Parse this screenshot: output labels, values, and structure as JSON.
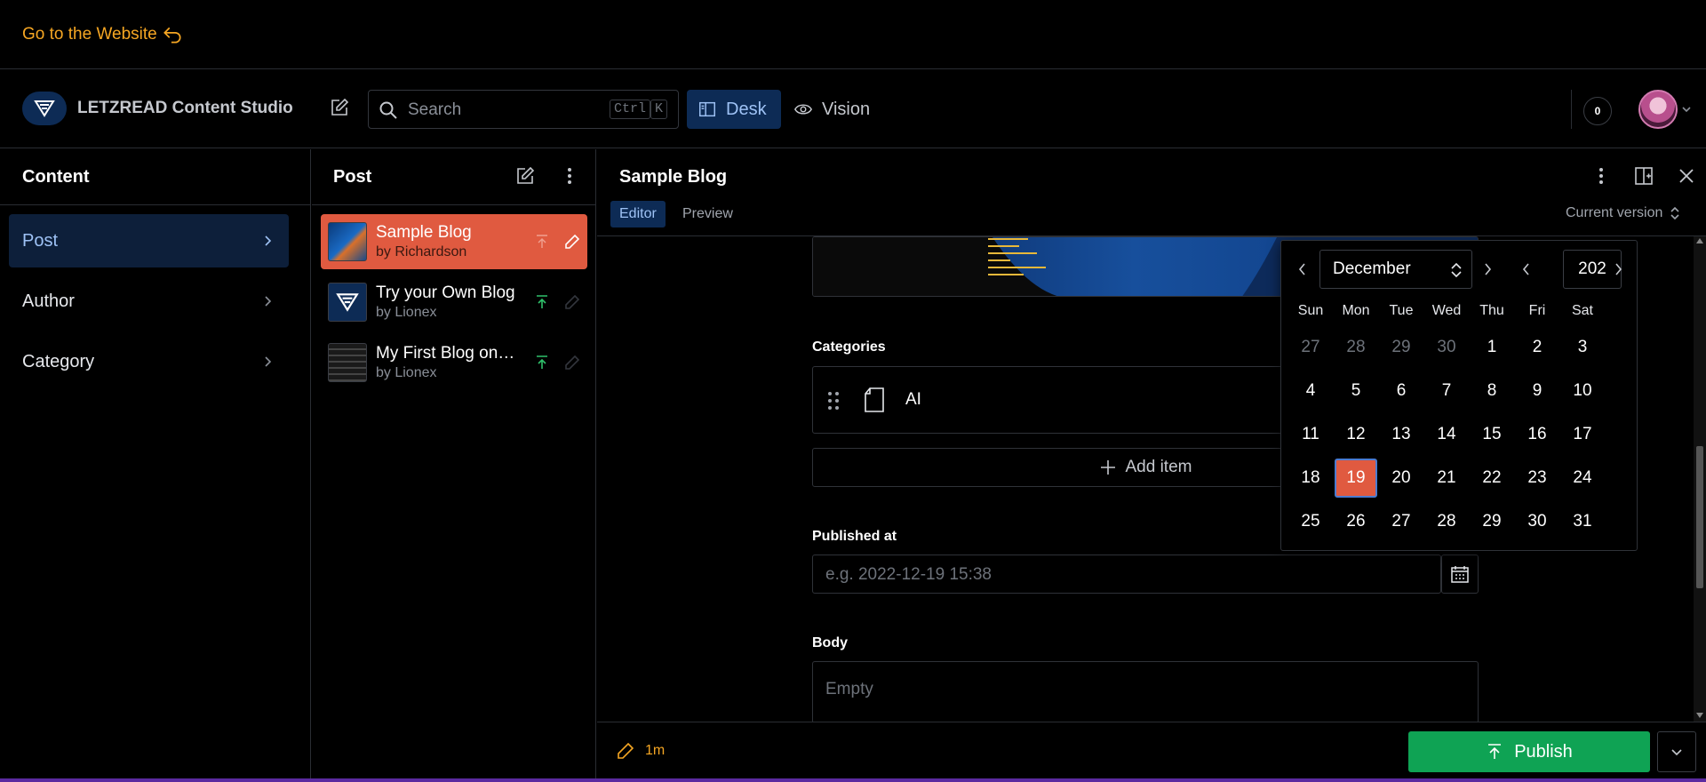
{
  "banner": {
    "link_label": "Go to the Website"
  },
  "navbar": {
    "brand_title": "LETZREAD Content Studio",
    "search_placeholder": "Search",
    "kbd_ctrl": "Ctrl",
    "kbd_k": "K",
    "desk_label": "Desk",
    "vision_label": "Vision",
    "notification_count": "0"
  },
  "content_pane": {
    "title": "Content",
    "items": [
      {
        "label": "Post"
      },
      {
        "label": "Author"
      },
      {
        "label": "Category"
      }
    ]
  },
  "post_pane": {
    "title": "Post",
    "documents": [
      {
        "title": "Sample Blog",
        "subtitle": "by Richardson"
      },
      {
        "title": "Try your Own Blog",
        "subtitle": "by Lionex"
      },
      {
        "title": "My First Blog on Sanity",
        "subtitle": "by Lionex"
      }
    ]
  },
  "document": {
    "title": "Sample Blog",
    "tabs": [
      {
        "label": "Editor"
      },
      {
        "label": "Preview"
      }
    ],
    "version_label": "Current version",
    "categories_label": "Categories",
    "category_item": "AI",
    "add_item_label": "Add item",
    "published_at_label": "Published at",
    "published_at_placeholder": "e.g. 2022-12-19 15:38",
    "body_label": "Body",
    "body_placeholder": "Empty"
  },
  "calendar": {
    "month": "December",
    "year": "202",
    "weekdays": [
      "Sun",
      "Mon",
      "Tue",
      "Wed",
      "Thu",
      "Fri",
      "Sat"
    ],
    "weeks": [
      [
        "27",
        "28",
        "29",
        "30",
        "1",
        "2",
        "3"
      ],
      [
        "4",
        "5",
        "6",
        "7",
        "8",
        "9",
        "10"
      ],
      [
        "11",
        "12",
        "13",
        "14",
        "15",
        "16",
        "17"
      ],
      [
        "18",
        "19",
        "20",
        "21",
        "22",
        "23",
        "24"
      ],
      [
        "25",
        "26",
        "27",
        "28",
        "29",
        "30",
        "31"
      ]
    ],
    "selected_day": "19"
  },
  "footer": {
    "edited_ago": "1m",
    "publish_label": "Publish"
  },
  "colors": {
    "accent_orange": "#e05a40",
    "publish_green": "#0fa354",
    "link_orange": "#f5a623",
    "selected_blue_bg": "#0d2b55"
  }
}
